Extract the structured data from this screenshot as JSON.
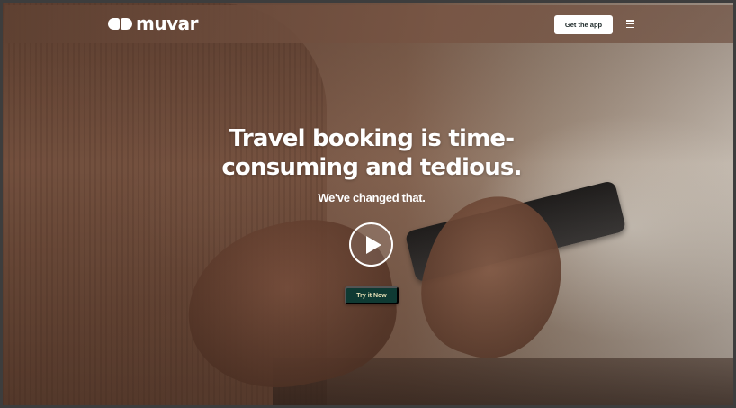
{
  "header": {
    "logo_text": "muvar",
    "logo_icon": "double-circle-logo-icon",
    "get_app_label": "Get the app",
    "menu_icon": "hamburger-menu-icon"
  },
  "hero": {
    "headline": "Travel booking is time-consuming and tedious.",
    "subheadline": "We've changed that.",
    "play_icon": "play-icon",
    "cta_label": "Try it Now"
  },
  "colors": {
    "cta_background": "#0f3a33",
    "cta_text": "#e9e2b8",
    "header_button_bg": "#ffffff"
  }
}
